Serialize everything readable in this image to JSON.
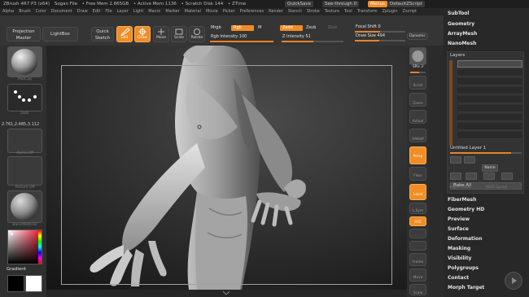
{
  "titlebar": {
    "app": "ZBrush 4R7 P3 (x64)",
    "project": "Sogan File",
    "free_mem": "• Free Mem 2.865GB",
    "active_mem": "• Active Mem 1136",
    "scratch_disk": "• Scratch Disk 144",
    "ztime": "• ZTime",
    "quicksave": "QuickSave",
    "see_through": "See-through  0",
    "menus": "Menus",
    "default_script": "DefaultZScript"
  },
  "menubar": [
    "Alpha",
    "Brush",
    "Color",
    "Document",
    "Draw",
    "Edit",
    "File",
    "Layer",
    "Light",
    "Macro",
    "Marker",
    "Material",
    "Movie",
    "Picker",
    "Preferences",
    "Render",
    "Stencil",
    "Stroke",
    "Texture",
    "Tool",
    "Transform",
    "Zplugin",
    "Zscript"
  ],
  "shelf": {
    "projection_master": "Projection Master",
    "lightbox": "LightBox",
    "quick_sketch": "Quick Sketch",
    "edit": "Edit",
    "draw": "Draw",
    "move": "Move",
    "scale": "Scale",
    "rotate": "Rotate",
    "mrgb": "Mrgb",
    "rgb": "Rgb",
    "m": "M",
    "zadd": "Zadd",
    "zsub": "Zsub",
    "zcut": "Zcut",
    "rgb_intensity": "Rgb Intensity 100",
    "z_intensity": "Z Intensity 51",
    "focal_shift": "Focal Shift 0",
    "draw_size": "Draw Size 494",
    "dynamic": "Dynamic"
  },
  "leftshelf": {
    "coords": "2.761,2.485,3.112",
    "mat_label": "MatCap",
    "dots_label": "Dots",
    "alpha_off": "Alpha Off",
    "texture_off": "Texture Off",
    "basic_material": "BasicMaterial",
    "gradient": "Gradient",
    "colors": {
      "main": "#ffffff",
      "secondary": "#000000"
    }
  },
  "rshelf": {
    "spix": "SPix 3",
    "scroll": "Scroll",
    "zoom": "Zoom",
    "actual": "Actual",
    "aahalf": "AAHalf",
    "persp": "Persp",
    "floor": "Floor",
    "local": "Local",
    "lsym": "L.Sym",
    "xyz": "XYZ",
    "frame": "Frame",
    "move": "Move",
    "scale": "Scale"
  },
  "palette": {
    "subtool": "SubTool",
    "geometry": "Geometry",
    "arraymesh": "ArrayMesh",
    "nanomesh": "NanoMesh",
    "layers": "Layers",
    "untitled_layer": "Untitled Layer 1",
    "name": "Name",
    "bake_all": "Bake All",
    "import_mdd": "Import MDD",
    "mdd_speed": "MDD Speed",
    "fibermesh": "FiberMesh",
    "geometry_hd": "Geometry HD",
    "preview": "Preview",
    "surface": "Surface",
    "deformation": "Deformation",
    "masking": "Masking",
    "visibility": "Visibility",
    "polygroups": "Polygroups",
    "contact": "Contact",
    "morph_target": "Morph Target"
  },
  "accent": "#f08d26"
}
